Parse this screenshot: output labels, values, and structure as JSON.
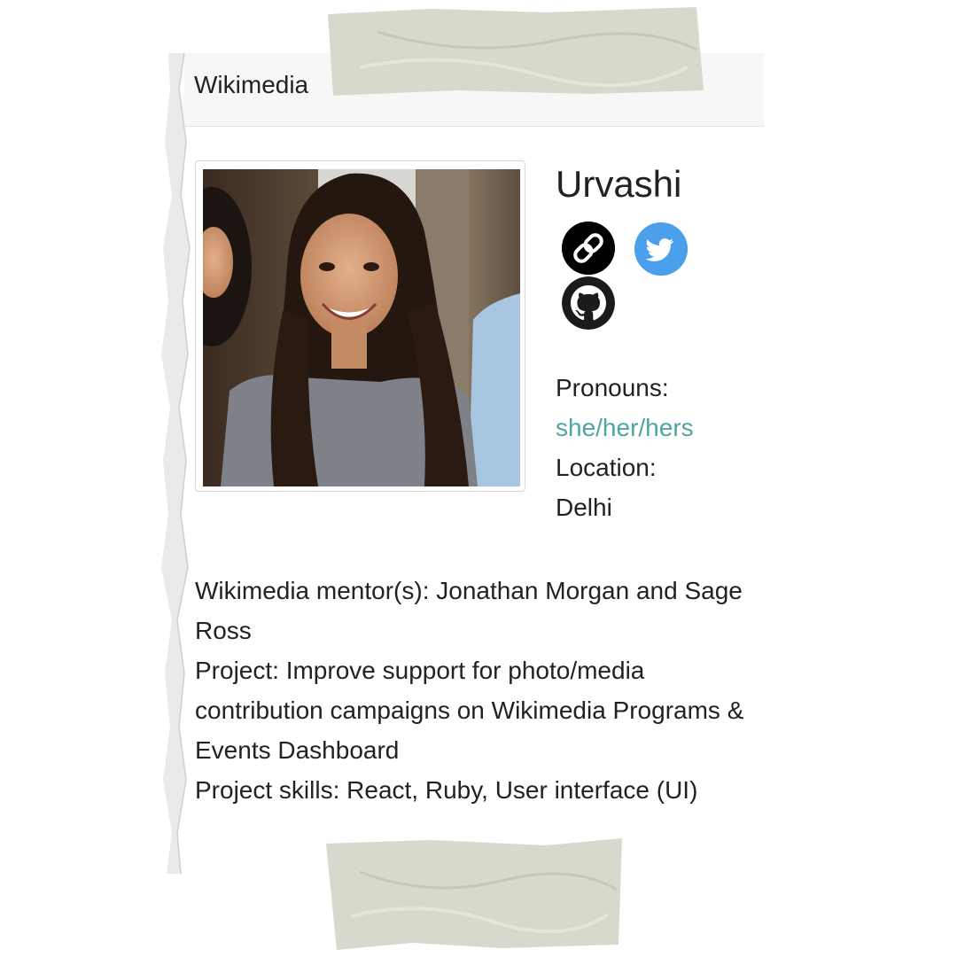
{
  "card": {
    "header_title": "Wikimedia"
  },
  "profile": {
    "name": "Urvashi",
    "photo_alt": "Urvashi",
    "social_icons": [
      "link-icon",
      "twitter-icon",
      "github-icon"
    ],
    "pronouns_label": "Pronouns:",
    "pronouns_value": "she/her/hers",
    "location_label": "Location:",
    "location_value": "Delhi"
  },
  "details": {
    "mentors": "Wikimedia mentor(s): Jonathan Morgan and Sage Ross",
    "project": "Project: Improve support for photo/media contribution campaigns on Wikimedia Programs & Events Dashboard",
    "skills": "Project skills: React, Ruby, User interface (UI)"
  },
  "colors": {
    "link_accent": "#4fa5a0",
    "twitter_blue": "#4aa0ea",
    "header_bg": "#f7f7f8",
    "tape": "#d9d8cd"
  }
}
